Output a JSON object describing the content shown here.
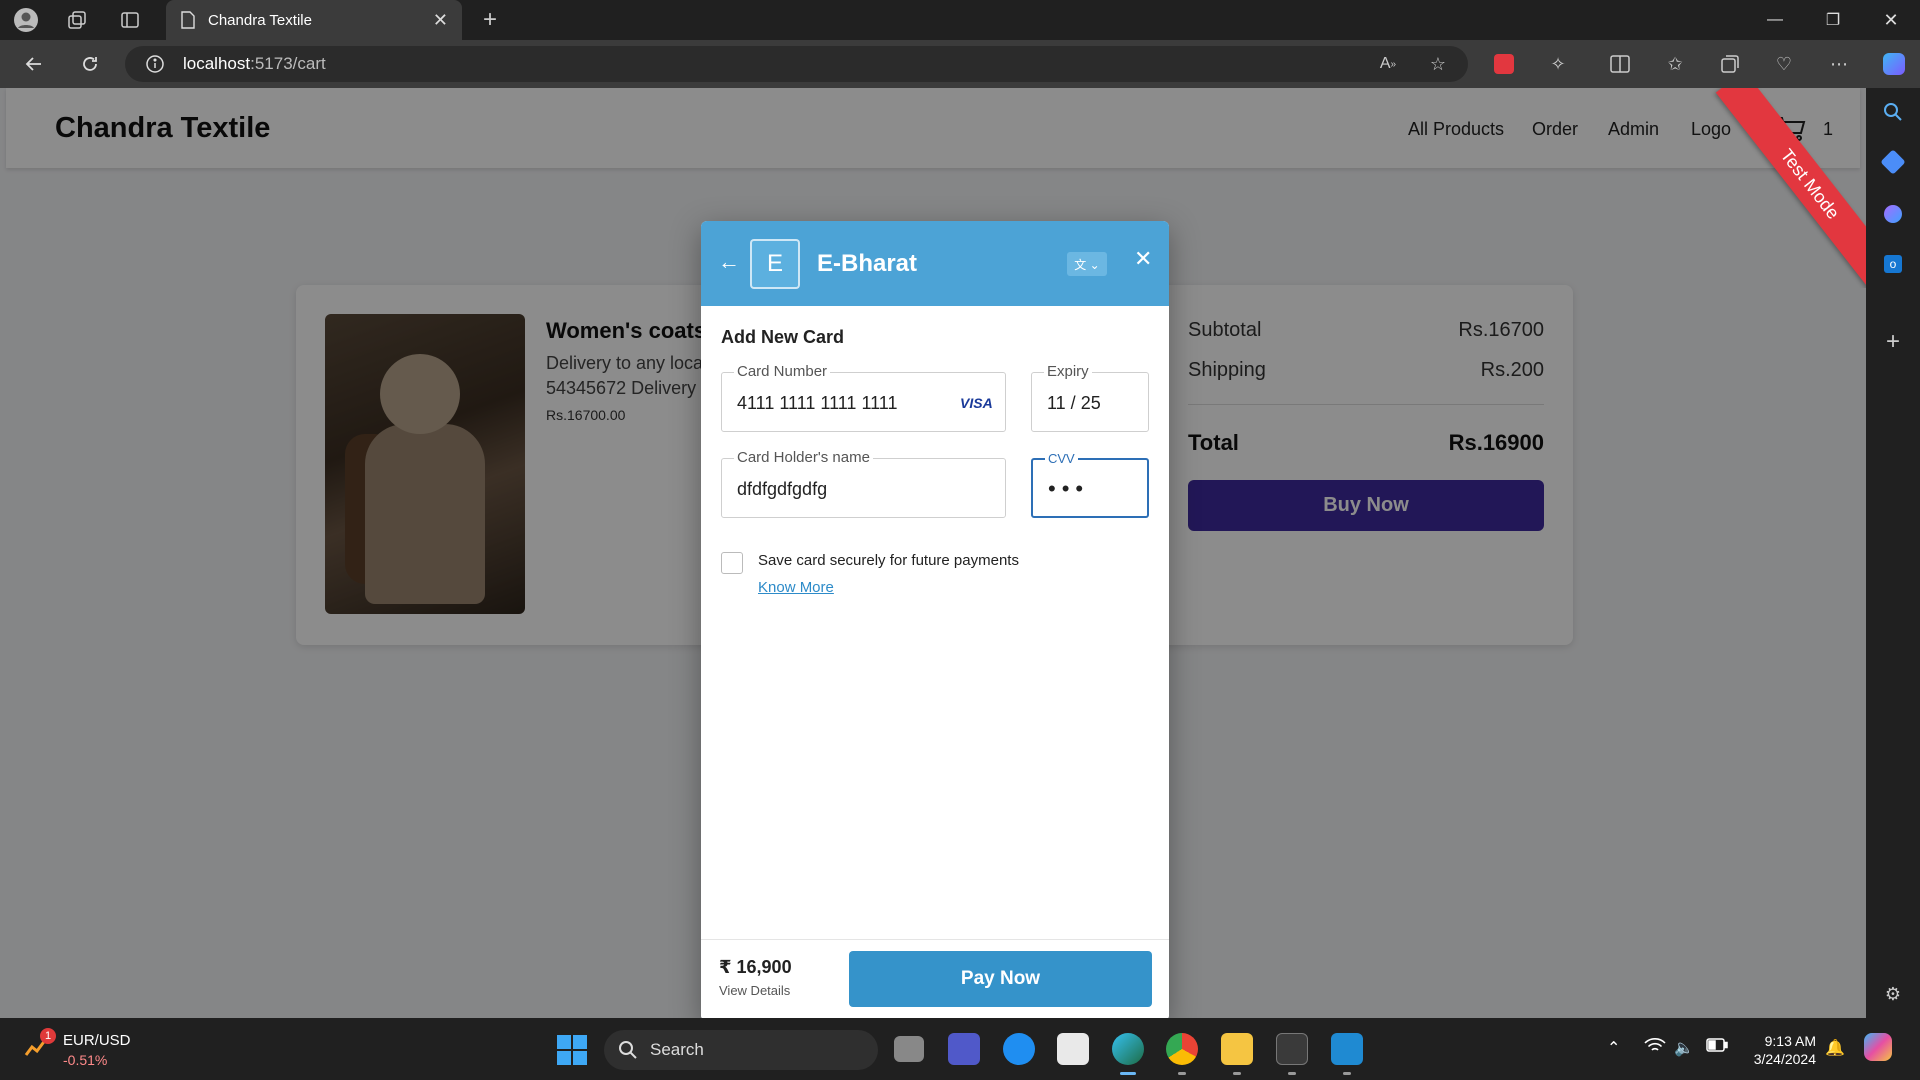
{
  "browser": {
    "tab_title": "Chandra Textile",
    "url_host": "localhost",
    "url_path": ":5173/cart"
  },
  "site": {
    "brand": "Chandra Textile",
    "nav": [
      "All Products",
      "Order",
      "Admin",
      "Logo"
    ],
    "cart_count": "1",
    "ribbon": "Test Mode"
  },
  "cart": {
    "item": {
      "name": "Women's coats",
      "description": "Delivery to any locat 54345672 Delivery c",
      "price": "Rs.16700.00"
    },
    "summary": {
      "subtotal_label": "Subtotal",
      "subtotal_value": "Rs.16700",
      "shipping_label": "Shipping",
      "shipping_value": "Rs.200",
      "total_label": "Total",
      "total_value": "Rs.16900",
      "buy_label": "Buy Now"
    }
  },
  "modal": {
    "logo_letter": "E",
    "title": "E-Bharat",
    "section_title": "Add New Card",
    "card_number_label": "Card Number",
    "card_number_value": "4111 1111 1111 1111",
    "card_brand": "VISA",
    "expiry_label": "Expiry",
    "expiry_value": "11 / 25",
    "holder_label": "Card Holder's name",
    "holder_value": "dfdfgdfgdfg",
    "cvv_label": "CVV",
    "cvv_value": "•••",
    "save_label": "Save card securely for future payments",
    "know_more": "Know More",
    "amount": "₹ 16,900",
    "view_details": "View Details",
    "pay_label": "Pay Now"
  },
  "taskbar": {
    "ticker_name": "EUR/USD",
    "ticker_change": "-0.51%",
    "ticker_badge": "1",
    "search_label": "Search",
    "time": "9:13 AM",
    "date": "3/24/2024"
  },
  "colors": {
    "modal_header": "#4ca3d6",
    "pay_button": "#3593ca",
    "buy_button": "#3f2a9e",
    "ribbon": "#e2373f"
  }
}
